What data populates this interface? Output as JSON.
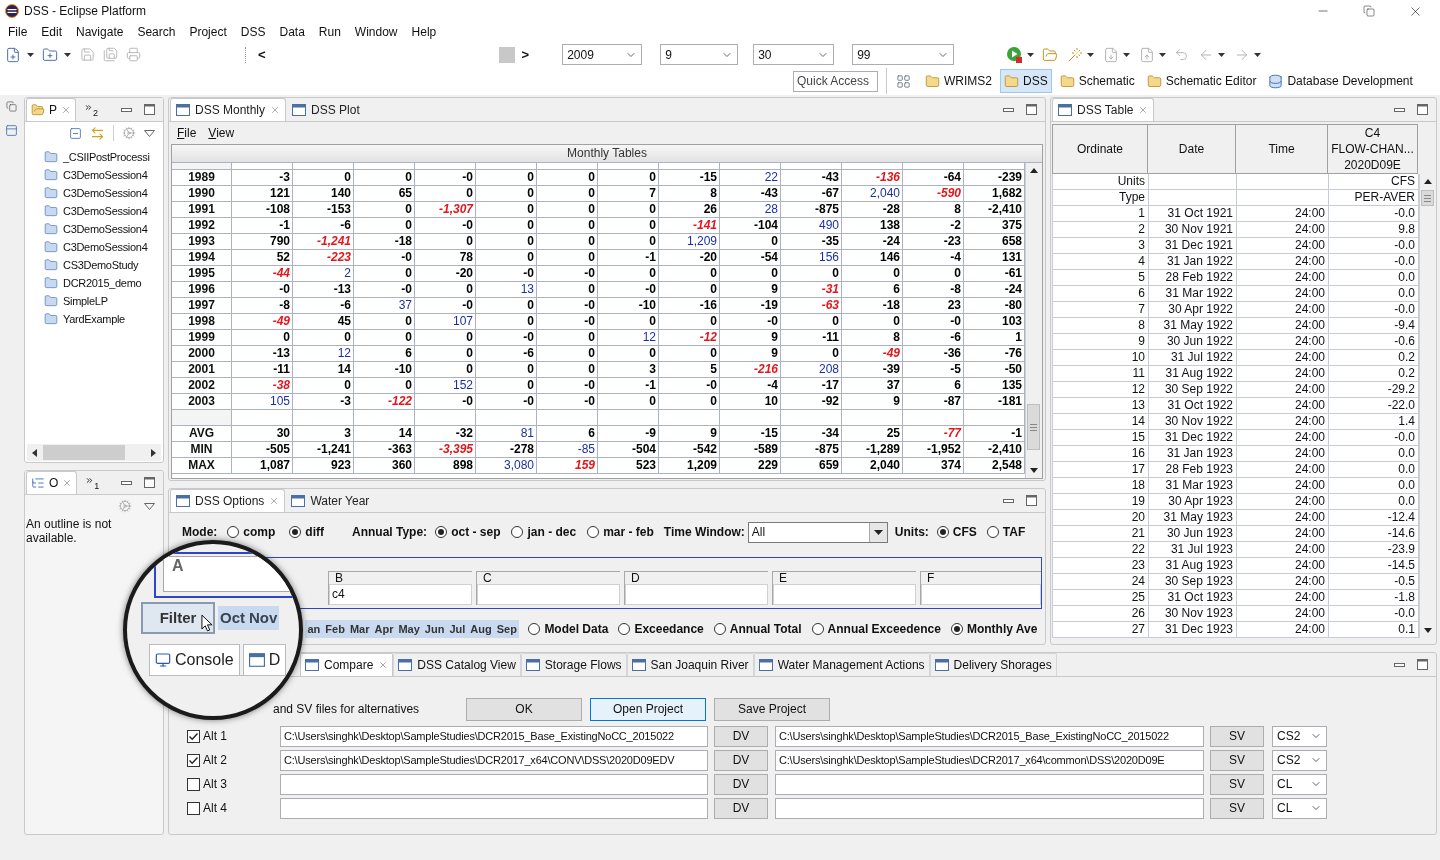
{
  "window": {
    "title": "DSS - Eclipse Platform"
  },
  "menu_bar": [
    "File",
    "Edit",
    "Navigate",
    "Search",
    "Project",
    "DSS",
    "Data",
    "Run",
    "Window",
    "Help"
  ],
  "toolbar": {
    "scroll_prev": "<",
    "scroll_next": ">",
    "combos": [
      {
        "value": "2009"
      },
      {
        "value": "9"
      },
      {
        "value": "30"
      },
      {
        "value": "99"
      }
    ]
  },
  "quick_access": {
    "placeholder": "Quick Access"
  },
  "perspectives": [
    {
      "label": "WRIMS2",
      "selected": false
    },
    {
      "label": "DSS",
      "selected": true
    },
    {
      "label": "Schematic",
      "selected": false
    },
    {
      "label": "Schematic Editor",
      "selected": false
    },
    {
      "label": "Database Development",
      "selected": false
    }
  ],
  "project_explorer": {
    "tab": {
      "label": "P",
      "selected": true
    },
    "overflow_count": "2",
    "items": [
      "_CSIIPostProcessi",
      "C3DemoSession4",
      "C3DemoSession4",
      "C3DemoSession4",
      "C3DemoSession4",
      "C3DemoSession4",
      "CS3DemoStudy",
      "DCR2015_demo",
      "SimpleLP",
      "YardExample"
    ]
  },
  "outline": {
    "tab": {
      "label": "O",
      "selected": true
    },
    "overflow_count": "1",
    "message": "An outline is not available."
  },
  "dss_monthly": {
    "tabs": [
      {
        "label": "DSS Monthly",
        "selected": true
      },
      {
        "label": "DSS Plot",
        "selected": false
      }
    ],
    "menu": [
      "File",
      "View"
    ],
    "table": {
      "title": "Monthly Tables",
      "rows": [
        {
          "label": "1989",
          "cells": [
            {
              "text": "-3",
              "kind": "plain"
            },
            {
              "text": "0",
              "kind": "plain"
            },
            {
              "text": "0",
              "kind": "plain"
            },
            {
              "text": "-0",
              "kind": "plain"
            },
            {
              "text": "0",
              "kind": "plain"
            },
            {
              "text": "0",
              "kind": "plain"
            },
            {
              "text": "0",
              "kind": "plain"
            },
            {
              "text": "-15",
              "kind": "plain"
            },
            {
              "text": "22",
              "kind": "high"
            },
            {
              "text": "-43",
              "kind": "plain"
            },
            {
              "text": "-136",
              "kind": "low"
            },
            {
              "text": "-64",
              "kind": "plain"
            },
            {
              "text": "-239",
              "kind": "plain"
            }
          ]
        },
        {
          "label": "1990",
          "cells": [
            {
              "text": "121",
              "kind": "plain"
            },
            {
              "text": "140",
              "kind": "plain"
            },
            {
              "text": "65",
              "kind": "plain"
            },
            {
              "text": "0",
              "kind": "plain"
            },
            {
              "text": "0",
              "kind": "plain"
            },
            {
              "text": "0",
              "kind": "plain"
            },
            {
              "text": "7",
              "kind": "plain"
            },
            {
              "text": "8",
              "kind": "plain"
            },
            {
              "text": "-43",
              "kind": "plain"
            },
            {
              "text": "-67",
              "kind": "plain"
            },
            {
              "text": "2,040",
              "kind": "high"
            },
            {
              "text": "-590",
              "kind": "low"
            },
            {
              "text": "1,682",
              "kind": "plain"
            }
          ]
        },
        {
          "label": "1991",
          "cells": [
            {
              "text": "-108",
              "kind": "plain"
            },
            {
              "text": "-153",
              "kind": "plain"
            },
            {
              "text": "0",
              "kind": "plain"
            },
            {
              "text": "-1,307",
              "kind": "low"
            },
            {
              "text": "0",
              "kind": "plain"
            },
            {
              "text": "0",
              "kind": "plain"
            },
            {
              "text": "0",
              "kind": "plain"
            },
            {
              "text": "26",
              "kind": "plain"
            },
            {
              "text": "28",
              "kind": "high"
            },
            {
              "text": "-875",
              "kind": "plain"
            },
            {
              "text": "-28",
              "kind": "plain"
            },
            {
              "text": "8",
              "kind": "plain"
            },
            {
              "text": "-2,410",
              "kind": "plain"
            }
          ]
        },
        {
          "label": "1992",
          "cells": [
            {
              "text": "-1",
              "kind": "plain"
            },
            {
              "text": "-6",
              "kind": "plain"
            },
            {
              "text": "0",
              "kind": "plain"
            },
            {
              "text": "-0",
              "kind": "plain"
            },
            {
              "text": "0",
              "kind": "plain"
            },
            {
              "text": "0",
              "kind": "plain"
            },
            {
              "text": "0",
              "kind": "plain"
            },
            {
              "text": "-141",
              "kind": "low"
            },
            {
              "text": "-104",
              "kind": "plain"
            },
            {
              "text": "490",
              "kind": "high"
            },
            {
              "text": "138",
              "kind": "plain"
            },
            {
              "text": "-2",
              "kind": "plain"
            },
            {
              "text": "375",
              "kind": "plain"
            }
          ]
        },
        {
          "label": "1993",
          "cells": [
            {
              "text": "790",
              "kind": "plain"
            },
            {
              "text": "-1,241",
              "kind": "low"
            },
            {
              "text": "-18",
              "kind": "plain"
            },
            {
              "text": "0",
              "kind": "plain"
            },
            {
              "text": "0",
              "kind": "plain"
            },
            {
              "text": "0",
              "kind": "plain"
            },
            {
              "text": "0",
              "kind": "plain"
            },
            {
              "text": "1,209",
              "kind": "high"
            },
            {
              "text": "0",
              "kind": "plain"
            },
            {
              "text": "-35",
              "kind": "plain"
            },
            {
              "text": "-24",
              "kind": "plain"
            },
            {
              "text": "-23",
              "kind": "plain"
            },
            {
              "text": "658",
              "kind": "plain"
            }
          ]
        },
        {
          "label": "1994",
          "cells": [
            {
              "text": "52",
              "kind": "plain"
            },
            {
              "text": "-223",
              "kind": "low"
            },
            {
              "text": "-0",
              "kind": "plain"
            },
            {
              "text": "78",
              "kind": "plain"
            },
            {
              "text": "0",
              "kind": "plain"
            },
            {
              "text": "0",
              "kind": "plain"
            },
            {
              "text": "-1",
              "kind": "plain"
            },
            {
              "text": "-20",
              "kind": "plain"
            },
            {
              "text": "-54",
              "kind": "plain"
            },
            {
              "text": "156",
              "kind": "high"
            },
            {
              "text": "146",
              "kind": "plain"
            },
            {
              "text": "-4",
              "kind": "plain"
            },
            {
              "text": "131",
              "kind": "plain"
            }
          ]
        },
        {
          "label": "1995",
          "cells": [
            {
              "text": "-44",
              "kind": "low"
            },
            {
              "text": "2",
              "kind": "high"
            },
            {
              "text": "0",
              "kind": "plain"
            },
            {
              "text": "-20",
              "kind": "plain"
            },
            {
              "text": "-0",
              "kind": "plain"
            },
            {
              "text": "-0",
              "kind": "plain"
            },
            {
              "text": "0",
              "kind": "plain"
            },
            {
              "text": "0",
              "kind": "plain"
            },
            {
              "text": "0",
              "kind": "plain"
            },
            {
              "text": "0",
              "kind": "plain"
            },
            {
              "text": "0",
              "kind": "plain"
            },
            {
              "text": "0",
              "kind": "plain"
            },
            {
              "text": "-61",
              "kind": "plain"
            }
          ]
        },
        {
          "label": "1996",
          "cells": [
            {
              "text": "-0",
              "kind": "plain"
            },
            {
              "text": "-13",
              "kind": "plain"
            },
            {
              "text": "-0",
              "kind": "plain"
            },
            {
              "text": "0",
              "kind": "plain"
            },
            {
              "text": "13",
              "kind": "high"
            },
            {
              "text": "0",
              "kind": "plain"
            },
            {
              "text": "-0",
              "kind": "plain"
            },
            {
              "text": "0",
              "kind": "plain"
            },
            {
              "text": "9",
              "kind": "plain"
            },
            {
              "text": "-31",
              "kind": "low"
            },
            {
              "text": "6",
              "kind": "plain"
            },
            {
              "text": "-8",
              "kind": "plain"
            },
            {
              "text": "-24",
              "kind": "plain"
            }
          ]
        },
        {
          "label": "1997",
          "cells": [
            {
              "text": "-8",
              "kind": "plain"
            },
            {
              "text": "-6",
              "kind": "plain"
            },
            {
              "text": "37",
              "kind": "high"
            },
            {
              "text": "-0",
              "kind": "plain"
            },
            {
              "text": "0",
              "kind": "plain"
            },
            {
              "text": "-0",
              "kind": "plain"
            },
            {
              "text": "-10",
              "kind": "plain"
            },
            {
              "text": "-16",
              "kind": "plain"
            },
            {
              "text": "-19",
              "kind": "plain"
            },
            {
              "text": "-63",
              "kind": "low"
            },
            {
              "text": "-18",
              "kind": "plain"
            },
            {
              "text": "23",
              "kind": "plain"
            },
            {
              "text": "-80",
              "kind": "plain"
            }
          ]
        },
        {
          "label": "1998",
          "cells": [
            {
              "text": "-49",
              "kind": "low"
            },
            {
              "text": "45",
              "kind": "plain"
            },
            {
              "text": "0",
              "kind": "plain"
            },
            {
              "text": "107",
              "kind": "high"
            },
            {
              "text": "0",
              "kind": "plain"
            },
            {
              "text": "-0",
              "kind": "plain"
            },
            {
              "text": "0",
              "kind": "plain"
            },
            {
              "text": "0",
              "kind": "plain"
            },
            {
              "text": "-0",
              "kind": "plain"
            },
            {
              "text": "0",
              "kind": "plain"
            },
            {
              "text": "0",
              "kind": "plain"
            },
            {
              "text": "-0",
              "kind": "plain"
            },
            {
              "text": "103",
              "kind": "plain"
            }
          ]
        },
        {
          "label": "1999",
          "cells": [
            {
              "text": "0",
              "kind": "plain"
            },
            {
              "text": "0",
              "kind": "plain"
            },
            {
              "text": "0",
              "kind": "plain"
            },
            {
              "text": "0",
              "kind": "plain"
            },
            {
              "text": "-0",
              "kind": "plain"
            },
            {
              "text": "0",
              "kind": "plain"
            },
            {
              "text": "12",
              "kind": "high"
            },
            {
              "text": "-12",
              "kind": "low"
            },
            {
              "text": "9",
              "kind": "plain"
            },
            {
              "text": "-11",
              "kind": "plain"
            },
            {
              "text": "8",
              "kind": "plain"
            },
            {
              "text": "-6",
              "kind": "plain"
            },
            {
              "text": "1",
              "kind": "plain"
            }
          ]
        },
        {
          "label": "2000",
          "cells": [
            {
              "text": "-13",
              "kind": "plain"
            },
            {
              "text": "12",
              "kind": "high"
            },
            {
              "text": "6",
              "kind": "plain"
            },
            {
              "text": "0",
              "kind": "plain"
            },
            {
              "text": "-6",
              "kind": "plain"
            },
            {
              "text": "0",
              "kind": "plain"
            },
            {
              "text": "0",
              "kind": "plain"
            },
            {
              "text": "0",
              "kind": "plain"
            },
            {
              "text": "9",
              "kind": "plain"
            },
            {
              "text": "0",
              "kind": "plain"
            },
            {
              "text": "-49",
              "kind": "low"
            },
            {
              "text": "-36",
              "kind": "plain"
            },
            {
              "text": "-76",
              "kind": "plain"
            }
          ]
        },
        {
          "label": "2001",
          "cells": [
            {
              "text": "-11",
              "kind": "plain"
            },
            {
              "text": "14",
              "kind": "plain"
            },
            {
              "text": "-10",
              "kind": "plain"
            },
            {
              "text": "0",
              "kind": "plain"
            },
            {
              "text": "0",
              "kind": "plain"
            },
            {
              "text": "0",
              "kind": "plain"
            },
            {
              "text": "3",
              "kind": "plain"
            },
            {
              "text": "5",
              "kind": "plain"
            },
            {
              "text": "-216",
              "kind": "low"
            },
            {
              "text": "208",
              "kind": "high"
            },
            {
              "text": "-39",
              "kind": "plain"
            },
            {
              "text": "-5",
              "kind": "plain"
            },
            {
              "text": "-50",
              "kind": "plain"
            }
          ]
        },
        {
          "label": "2002",
          "cells": [
            {
              "text": "-38",
              "kind": "low"
            },
            {
              "text": "0",
              "kind": "plain"
            },
            {
              "text": "0",
              "kind": "plain"
            },
            {
              "text": "152",
              "kind": "high"
            },
            {
              "text": "0",
              "kind": "plain"
            },
            {
              "text": "-0",
              "kind": "plain"
            },
            {
              "text": "-1",
              "kind": "plain"
            },
            {
              "text": "-0",
              "kind": "plain"
            },
            {
              "text": "-4",
              "kind": "plain"
            },
            {
              "text": "-17",
              "kind": "plain"
            },
            {
              "text": "37",
              "kind": "plain"
            },
            {
              "text": "6",
              "kind": "plain"
            },
            {
              "text": "135",
              "kind": "plain"
            }
          ]
        },
        {
          "label": "2003",
          "cells": [
            {
              "text": "105",
              "kind": "high"
            },
            {
              "text": "-3",
              "kind": "plain"
            },
            {
              "text": "-122",
              "kind": "low"
            },
            {
              "text": "-0",
              "kind": "plain"
            },
            {
              "text": "-0",
              "kind": "plain"
            },
            {
              "text": "-0",
              "kind": "plain"
            },
            {
              "text": "0",
              "kind": "plain"
            },
            {
              "text": "0",
              "kind": "plain"
            },
            {
              "text": "10",
              "kind": "plain"
            },
            {
              "text": "-92",
              "kind": "plain"
            },
            {
              "text": "9",
              "kind": "plain"
            },
            {
              "text": "-87",
              "kind": "plain"
            },
            {
              "text": "-181",
              "kind": "plain"
            }
          ]
        }
      ],
      "summary_rows": [
        {
          "label": "AVG",
          "cells": [
            {
              "text": "30",
              "kind": "plain"
            },
            {
              "text": "3",
              "kind": "plain"
            },
            {
              "text": "14",
              "kind": "plain"
            },
            {
              "text": "-32",
              "kind": "plain"
            },
            {
              "text": "81",
              "kind": "high"
            },
            {
              "text": "6",
              "kind": "plain"
            },
            {
              "text": "-9",
              "kind": "plain"
            },
            {
              "text": "9",
              "kind": "plain"
            },
            {
              "text": "-15",
              "kind": "plain"
            },
            {
              "text": "-34",
              "kind": "plain"
            },
            {
              "text": "25",
              "kind": "plain"
            },
            {
              "text": "-77",
              "kind": "low"
            },
            {
              "text": "-1",
              "kind": "plain"
            }
          ]
        },
        {
          "label": "MIN",
          "cells": [
            {
              "text": "-505",
              "kind": "plain"
            },
            {
              "text": "-1,241",
              "kind": "plain"
            },
            {
              "text": "-363",
              "kind": "plain"
            },
            {
              "text": "-3,395",
              "kind": "low"
            },
            {
              "text": "-278",
              "kind": "plain"
            },
            {
              "text": "-85",
              "kind": "high"
            },
            {
              "text": "-504",
              "kind": "plain"
            },
            {
              "text": "-542",
              "kind": "plain"
            },
            {
              "text": "-589",
              "kind": "plain"
            },
            {
              "text": "-875",
              "kind": "plain"
            },
            {
              "text": "-1,289",
              "kind": "plain"
            },
            {
              "text": "-1,952",
              "kind": "plain"
            },
            {
              "text": "-2,410",
              "kind": "plain"
            }
          ]
        },
        {
          "label": "MAX",
          "cells": [
            {
              "text": "1,087",
              "kind": "plain"
            },
            {
              "text": "923",
              "kind": "plain"
            },
            {
              "text": "360",
              "kind": "plain"
            },
            {
              "text": "898",
              "kind": "plain"
            },
            {
              "text": "3,080",
              "kind": "high"
            },
            {
              "text": "159",
              "kind": "low"
            },
            {
              "text": "523",
              "kind": "plain"
            },
            {
              "text": "1,209",
              "kind": "plain"
            },
            {
              "text": "229",
              "kind": "plain"
            },
            {
              "text": "659",
              "kind": "plain"
            },
            {
              "text": "2,040",
              "kind": "plain"
            },
            {
              "text": "374",
              "kind": "plain"
            },
            {
              "text": "2,548",
              "kind": "plain"
            }
          ]
        }
      ]
    }
  },
  "dss_options": {
    "tabs": [
      {
        "label": "DSS Options",
        "selected": true
      },
      {
        "label": "Water Year",
        "selected": false
      }
    ],
    "mode": {
      "label": "Mode:",
      "options": [
        {
          "label": "comp",
          "selected": false
        },
        {
          "label": "diff",
          "selected": true
        }
      ]
    },
    "annual_type": {
      "label": "Annual Type:",
      "options": [
        {
          "label": "oct - sep",
          "selected": true
        },
        {
          "label": "jan - dec",
          "selected": false
        },
        {
          "label": "mar - feb",
          "selected": false
        }
      ]
    },
    "time_window": {
      "label": "Time Window:",
      "value": "All"
    },
    "units": {
      "label": "Units:",
      "options": [
        {
          "label": "CFS",
          "selected": true
        },
        {
          "label": "TAF",
          "selected": false
        }
      ]
    },
    "fields": [
      {
        "label": "B",
        "value": "c4"
      },
      {
        "label": "C"
      },
      {
        "label": "D"
      },
      {
        "label": "E"
      },
      {
        "label": "F"
      }
    ],
    "months": [
      {
        "label": "an",
        "selected": true
      },
      {
        "label": "Feb",
        "selected": true
      },
      {
        "label": "Mar",
        "selected": true
      },
      {
        "label": "Apr",
        "selected": true
      },
      {
        "label": "May",
        "selected": true
      },
      {
        "label": "Jun",
        "selected": true
      },
      {
        "label": "Jul",
        "selected": true
      },
      {
        "label": "Aug",
        "selected": true
      },
      {
        "label": "Sep",
        "selected": true
      }
    ],
    "views": [
      {
        "label": "Model Data",
        "selected": false
      },
      {
        "label": "Exceedance",
        "selected": false
      },
      {
        "label": "Annual Total",
        "selected": false
      },
      {
        "label": "Annual Exceedence",
        "selected": false
      },
      {
        "label": "Monthly Ave",
        "selected": true
      }
    ]
  },
  "dss_table": {
    "tab": {
      "label": "DSS Table",
      "selected": true
    },
    "columns": [
      "Ordinate",
      "Date",
      "Time"
    ],
    "series_header": [
      "C4",
      "FLOW-CHAN...",
      "2020D09E"
    ],
    "units": {
      "label": "Units",
      "value": "CFS"
    },
    "type": {
      "label": "Type",
      "value": "PER-AVER"
    },
    "rows": [
      [
        "1",
        "31 Oct 1921",
        "24:00",
        "-0.0"
      ],
      [
        "2",
        "30 Nov 1921",
        "24:00",
        "9.8"
      ],
      [
        "3",
        "31 Dec 1921",
        "24:00",
        "-0.0"
      ],
      [
        "4",
        "31 Jan 1922",
        "24:00",
        "-0.0"
      ],
      [
        "5",
        "28 Feb 1922",
        "24:00",
        "0.0"
      ],
      [
        "6",
        "31 Mar 1922",
        "24:00",
        "0.0"
      ],
      [
        "7",
        "30 Apr 1922",
        "24:00",
        "-0.0"
      ],
      [
        "8",
        "31 May 1922",
        "24:00",
        "-9.4"
      ],
      [
        "9",
        "30 Jun 1922",
        "24:00",
        "-0.6"
      ],
      [
        "10",
        "31 Jul 1922",
        "24:00",
        "0.2"
      ],
      [
        "11",
        "31 Aug 1922",
        "24:00",
        "0.2"
      ],
      [
        "12",
        "30 Sep 1922",
        "24:00",
        "-29.2"
      ],
      [
        "13",
        "31 Oct 1922",
        "24:00",
        "-22.0"
      ],
      [
        "14",
        "30 Nov 1922",
        "24:00",
        "1.4"
      ],
      [
        "15",
        "31 Dec 1922",
        "24:00",
        "-0.0"
      ],
      [
        "16",
        "31 Jan 1923",
        "24:00",
        "0.0"
      ],
      [
        "17",
        "28 Feb 1923",
        "24:00",
        "0.0"
      ],
      [
        "18",
        "31 Mar 1923",
        "24:00",
        "0.0"
      ],
      [
        "19",
        "30 Apr 1923",
        "24:00",
        "0.0"
      ],
      [
        "20",
        "31 May 1923",
        "24:00",
        "-12.4"
      ],
      [
        "21",
        "30 Jun 1923",
        "24:00",
        "-14.6"
      ],
      [
        "22",
        "31 Jul 1923",
        "24:00",
        "-23.9"
      ],
      [
        "23",
        "31 Aug 1923",
        "24:00",
        "-14.5"
      ],
      [
        "24",
        "30 Sep 1923",
        "24:00",
        "-0.5"
      ],
      [
        "25",
        "31 Oct 1923",
        "24:00",
        "-1.8"
      ],
      [
        "26",
        "30 Nov 1923",
        "24:00",
        "-0.0"
      ],
      [
        "27",
        "31 Dec 1923",
        "24:00",
        "0.1"
      ]
    ]
  },
  "bottom_panel": {
    "tabs": [
      {
        "label": "Compare",
        "selected": true
      },
      {
        "label": "DSS Catalog View",
        "selected": false
      },
      {
        "label": "Storage Flows",
        "selected": false
      },
      {
        "label": "San Joaquin River",
        "selected": false
      },
      {
        "label": "Water Management Actions",
        "selected": false
      },
      {
        "label": "Delivery Shorages",
        "selected": false
      }
    ],
    "instruction": "and SV files for alternatives",
    "buttons": [
      {
        "label": "OK",
        "focused": false
      },
      {
        "label": "Open Project",
        "focused": true
      },
      {
        "label": "Save Project",
        "focused": false
      }
    ],
    "alternatives": [
      {
        "label": "Alt 1",
        "checked": true,
        "dv_path": "C:\\Users\\singhk\\Desktop\\SampleStudies\\DCR2015_Base_ExistingNoCC_2015022",
        "dv_button": "DV",
        "sv_path": "C:\\Users\\singhk\\Desktop\\SampleStudies\\DCR2015_Base_ExistingNoCC_2015022",
        "sv_button": "SV",
        "format": "CS2"
      },
      {
        "label": "Alt 2",
        "checked": true,
        "dv_path": "C:\\Users\\singhk\\Desktop\\SampleStudies\\DCR2017_x64\\CONV\\DSS\\2020D09EDV",
        "dv_button": "DV",
        "sv_path": "C:\\Users\\singhk\\Desktop\\SampleStudies\\DCR2017_x64\\common\\DSS\\2020D09E",
        "sv_button": "SV",
        "format": "CS2"
      },
      {
        "label": "Alt 3",
        "checked": false,
        "dv_button": "DV",
        "sv_button": "SV",
        "format": "CL"
      },
      {
        "label": "Alt 4",
        "checked": false,
        "dv_button": "DV",
        "sv_button": "SV",
        "format": "CL"
      }
    ]
  },
  "magnifier": {
    "group_label": "A",
    "filter_button": "Filter",
    "months": [
      {
        "label": "Oct",
        "selected": true
      },
      {
        "label": "Nov",
        "selected": true
      }
    ],
    "tabs": [
      "Console",
      "D"
    ]
  }
}
